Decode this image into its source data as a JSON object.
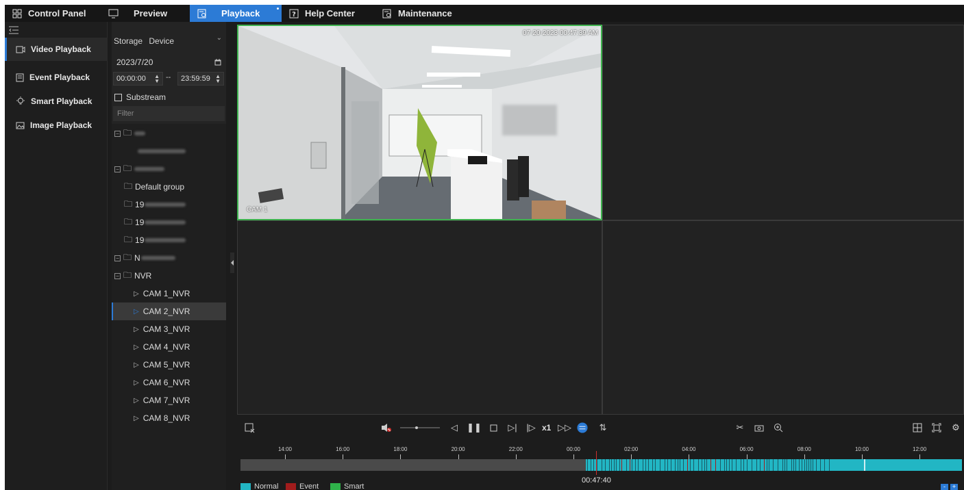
{
  "nav": {
    "tabs": [
      {
        "label": "Control Panel",
        "icon": "grid-icon"
      },
      {
        "label": "Preview",
        "icon": "monitor-icon"
      },
      {
        "label": "Playback",
        "icon": "playback-icon",
        "active": true
      },
      {
        "label": "Help Center",
        "icon": "help-icon"
      },
      {
        "label": "Maintenance",
        "icon": "maintenance-icon"
      }
    ]
  },
  "menu": {
    "items": [
      {
        "label": "Video Playback",
        "icon": "video-icon",
        "active": true
      },
      {
        "label": "Event Playback",
        "icon": "document-icon"
      },
      {
        "label": "Smart Playback",
        "icon": "bulb-icon"
      },
      {
        "label": "Image Playback",
        "icon": "image-icon"
      }
    ]
  },
  "panel": {
    "storage_label": "Storage",
    "storage_value": "Device",
    "date": "2023/7/20",
    "start_time": "00:00:00",
    "end_time": "23:59:59",
    "range_separator": "--",
    "substream_label": "Substream",
    "filter_placeholder": "Filter"
  },
  "tree": {
    "default_group": "Default group",
    "ip_prefix": "19",
    "new_group_prefix": "N",
    "nvr_label": "NVR",
    "cameras": [
      "CAM 1_NVR",
      "CAM 2_NVR",
      "CAM 3_NVR",
      "CAM 4_NVR",
      "CAM 5_NVR",
      "CAM 6_NVR",
      "CAM 7_NVR",
      "CAM 8_NVR"
    ],
    "selected_camera": "CAM 2_NVR"
  },
  "video": {
    "osd_timestamp": "07-20-2023 00:47:39 AM",
    "osd_name": "CAM 1"
  },
  "controls": {
    "speed": "x1"
  },
  "timeline": {
    "ticks": [
      "14:00",
      "16:00",
      "18:00",
      "20:00",
      "22:00",
      "00:00",
      "02:00",
      "04:00",
      "06:00",
      "08:00",
      "10:00",
      "12:00"
    ],
    "current_time": "00:47:40",
    "legend": [
      {
        "label": "Normal",
        "color": "#22b6c4"
      },
      {
        "label": "Event",
        "color": "#a11c1c"
      },
      {
        "label": "Smart",
        "color": "#2fb24a"
      }
    ]
  },
  "colors": {
    "accent": "#2c7bd6",
    "active_cell_border": "#3fb34f",
    "recording_normal": "#22b6c4",
    "cursor": "#d0302e"
  }
}
